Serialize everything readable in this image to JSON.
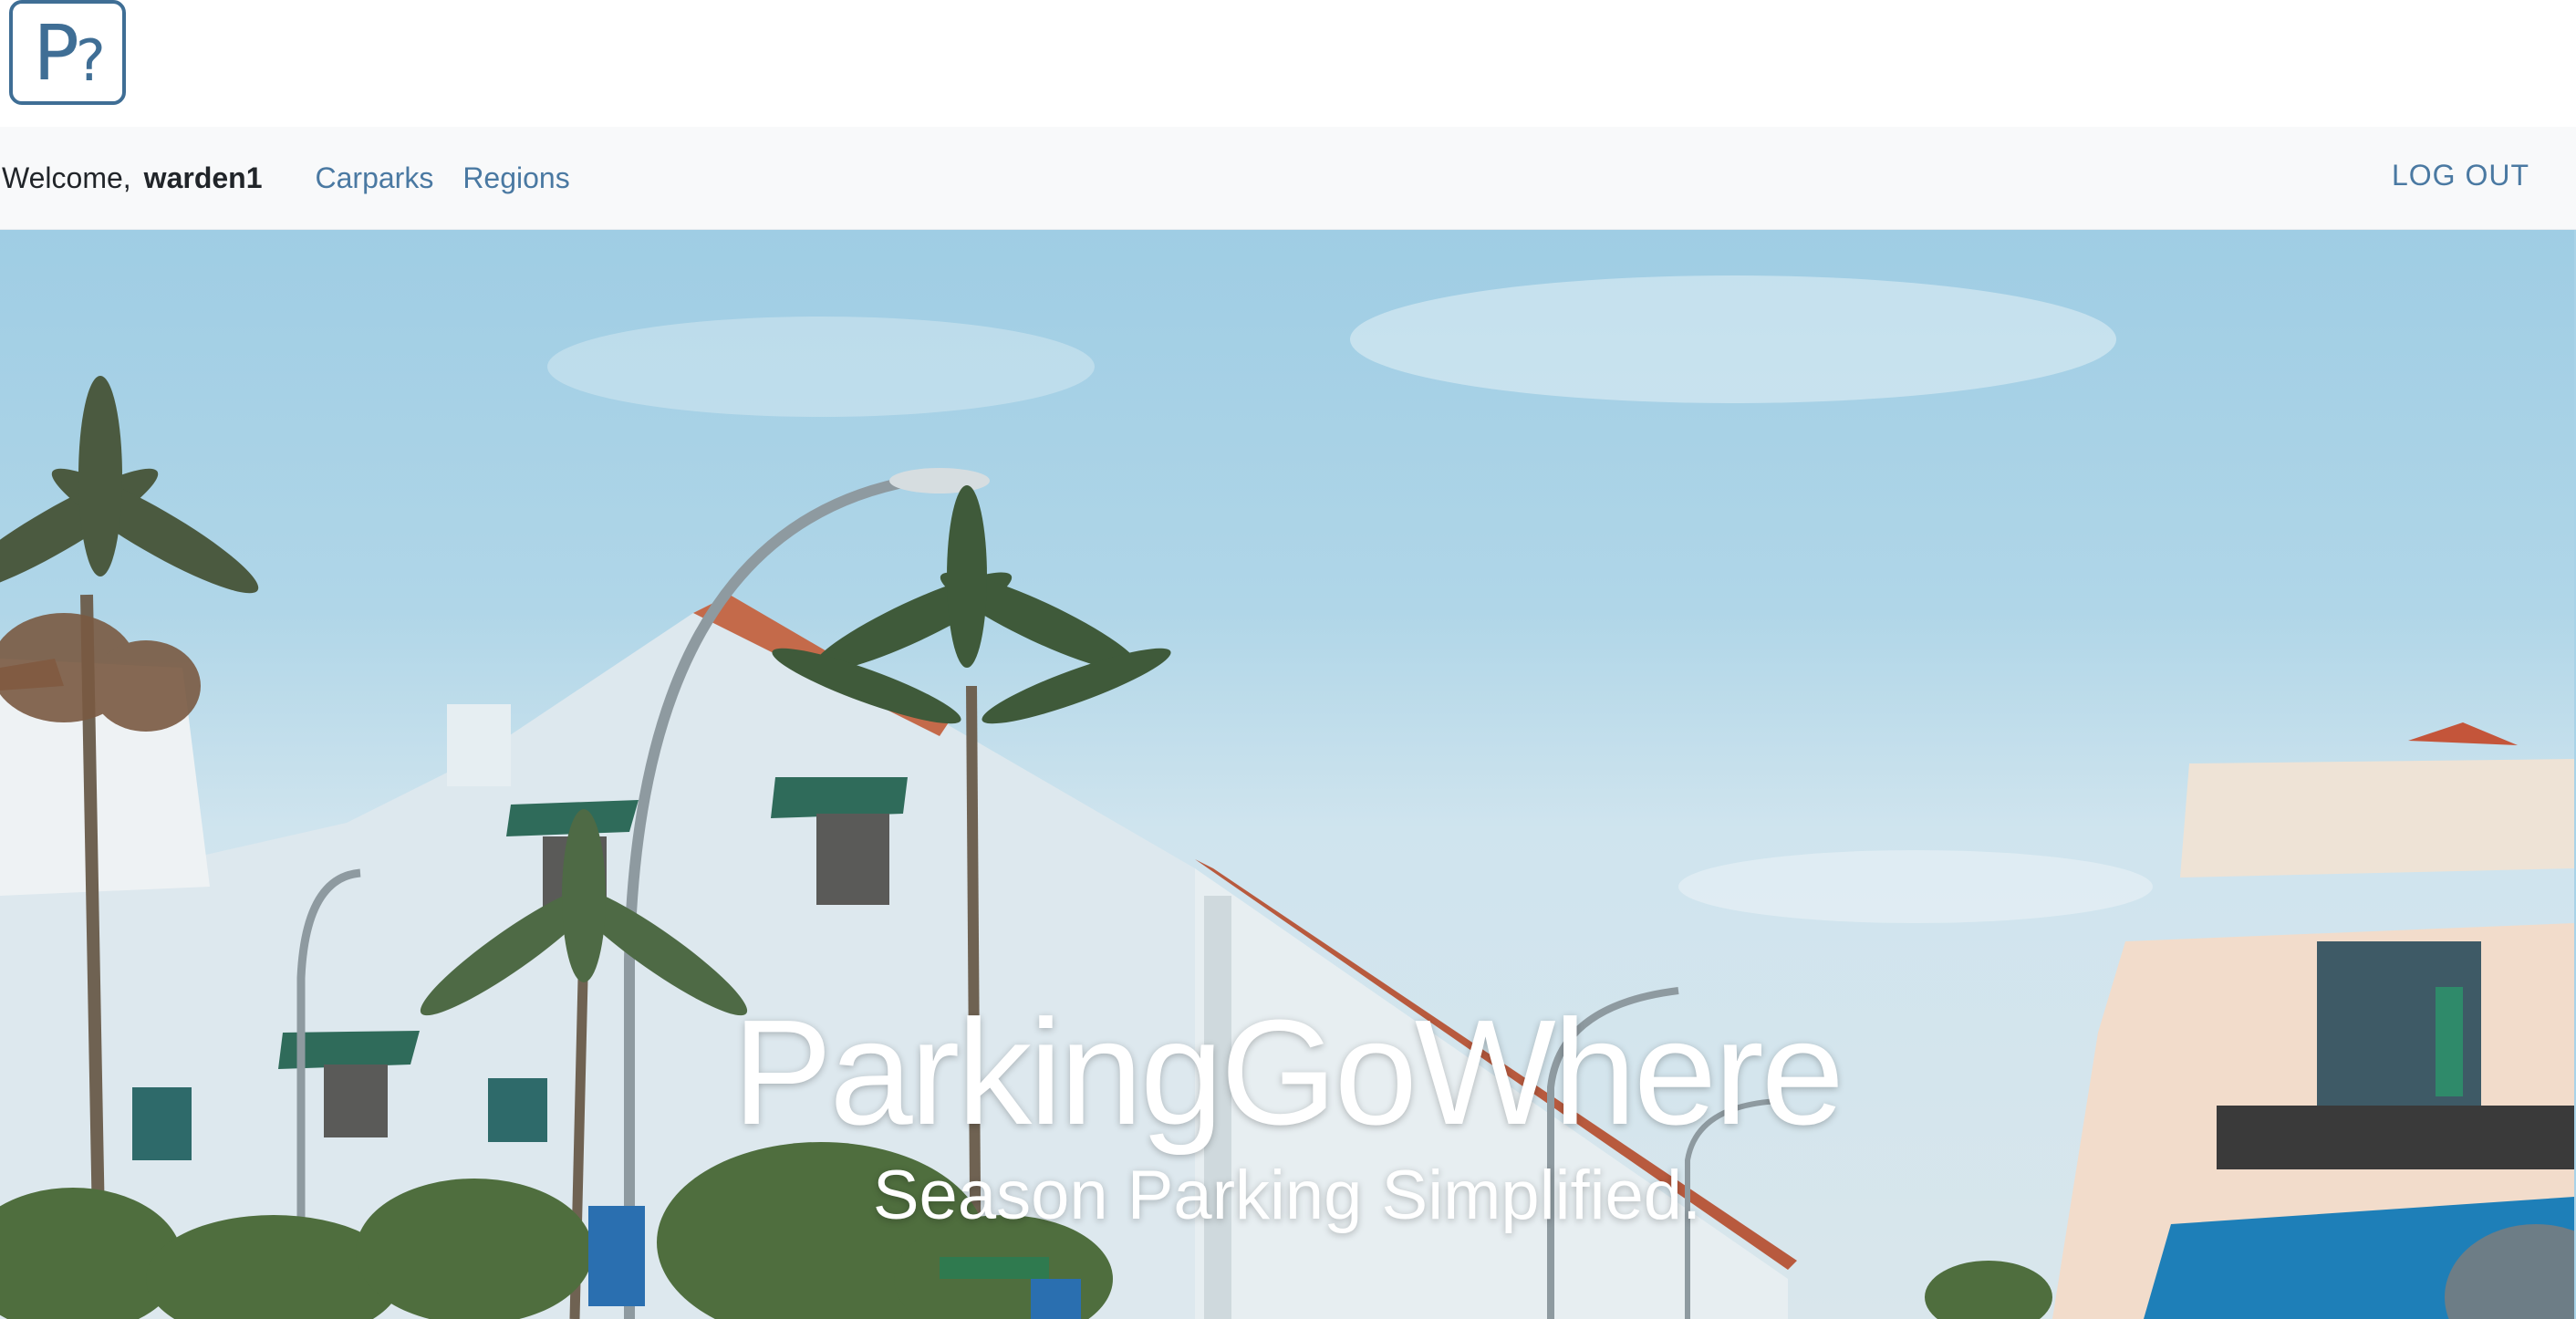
{
  "brand": {
    "logo_letter": "P",
    "logo_mark": "?",
    "logo_color": "#3f6e95"
  },
  "nav": {
    "welcome_label": "Welcome,",
    "username": "warden1",
    "links": [
      "Carparks",
      "Regions"
    ],
    "logout_label": "LOG OUT",
    "link_color": "#4a79a2"
  },
  "hero": {
    "title": "ParkingGoWhere",
    "subtitle": "Season Parking Simplified.",
    "image": "street-photo"
  }
}
